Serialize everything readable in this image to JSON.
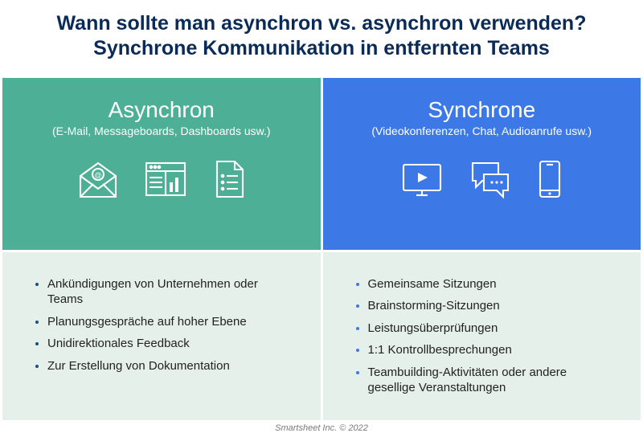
{
  "title_line1": "Wann sollte man asynchron vs. asynchron verwenden?",
  "title_line2": "Synchrone Kommunikation in entfernten Teams",
  "left": {
    "heading": "Asynchron",
    "sub": "(E-Mail, Messageboards, Dashboards usw.)",
    "items": [
      "Ankündigungen von Unternehmen oder Teams",
      "Planungsgespräche auf hoher Ebene",
      "Unidirektionales Feedback",
      "Zur Erstellung von Dokumentation"
    ]
  },
  "right": {
    "heading": "Synchrone",
    "sub": "(Videokonferenzen, Chat, Audioanrufe usw.)",
    "items": [
      "Gemeinsame Sitzungen",
      "Brainstorming-Sitzungen",
      "Leistungsüberprüfungen",
      "1:1 Kontrollbesprechungen",
      "Teambuilding-Aktivitäten oder andere gesellige Veranstaltungen"
    ]
  },
  "footer": "Smartsheet Inc. © 2022"
}
